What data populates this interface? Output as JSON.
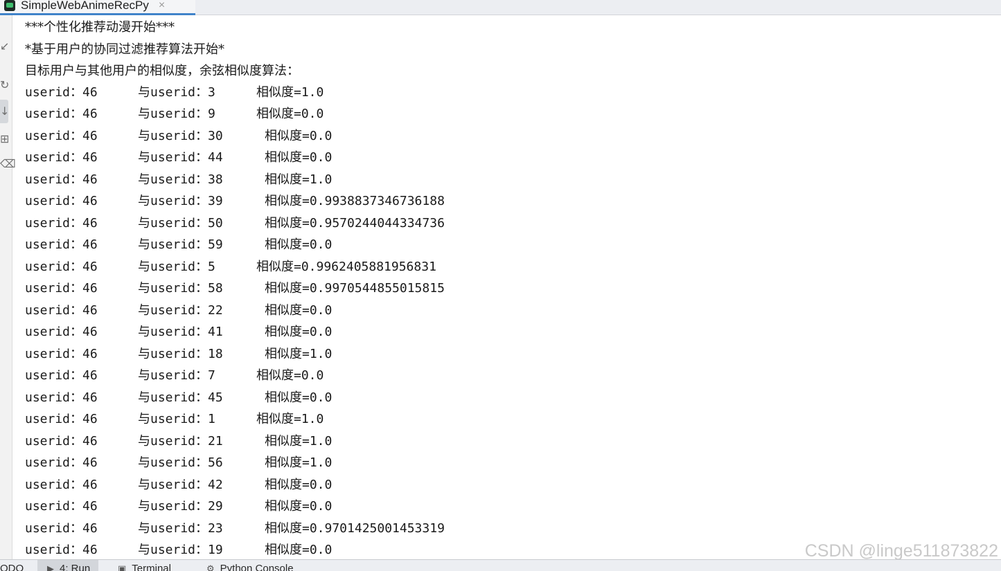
{
  "tab": {
    "title": "SimpleWebAnimeRecPy",
    "close_glyph": "×"
  },
  "gutter": {
    "icons": [
      "↙",
      "↻",
      "↓",
      "⊞",
      "⌫"
    ]
  },
  "console": {
    "header_lines": [
      "***个性化推荐动漫开始***",
      "*基于用户的协同过滤推荐算法开始*",
      "目标用户与其他用户的相似度，余弦相似度算法："
    ],
    "rows": [
      {
        "user": "userid：46",
        "other": "与userid：3",
        "sim": "相似度=1.0"
      },
      {
        "user": "userid：46",
        "other": "与userid：9",
        "sim": "相似度=0.0"
      },
      {
        "user": "userid：46",
        "other": "与userid：30",
        "sim": "相似度=0.0"
      },
      {
        "user": "userid：46",
        "other": "与userid：44",
        "sim": "相似度=0.0"
      },
      {
        "user": "userid：46",
        "other": "与userid：38",
        "sim": "相似度=1.0"
      },
      {
        "user": "userid：46",
        "other": "与userid：39",
        "sim": "相似度=0.9938837346736188"
      },
      {
        "user": "userid：46",
        "other": "与userid：50",
        "sim": "相似度=0.9570244044334736"
      },
      {
        "user": "userid：46",
        "other": "与userid：59",
        "sim": "相似度=0.0"
      },
      {
        "user": "userid：46",
        "other": "与userid：5",
        "sim": "相似度=0.9962405881956831"
      },
      {
        "user": "userid：46",
        "other": "与userid：58",
        "sim": "相似度=0.9970544855015815"
      },
      {
        "user": "userid：46",
        "other": "与userid：22",
        "sim": "相似度=0.0"
      },
      {
        "user": "userid：46",
        "other": "与userid：41",
        "sim": "相似度=0.0"
      },
      {
        "user": "userid：46",
        "other": "与userid：18",
        "sim": "相似度=1.0"
      },
      {
        "user": "userid：46",
        "other": "与userid：7",
        "sim": "相似度=0.0"
      },
      {
        "user": "userid：46",
        "other": "与userid：45",
        "sim": "相似度=0.0"
      },
      {
        "user": "userid：46",
        "other": "与userid：1",
        "sim": "相似度=1.0"
      },
      {
        "user": "userid：46",
        "other": "与userid：21",
        "sim": "相似度=1.0"
      },
      {
        "user": "userid：46",
        "other": "与userid：56",
        "sim": "相似度=1.0"
      },
      {
        "user": "userid：46",
        "other": "与userid：42",
        "sim": "相似度=0.0"
      },
      {
        "user": "userid：46",
        "other": "与userid：29",
        "sim": "相似度=0.0"
      },
      {
        "user": "userid：46",
        "other": "与userid：23",
        "sim": "相似度=0.9701425001453319"
      },
      {
        "user": "userid：46",
        "other": "与userid：19",
        "sim": "相似度=0.0"
      }
    ]
  },
  "watermark": "CSDN @linge511873822",
  "statusbar": {
    "todo": "ODO",
    "run": "4: Run",
    "terminal": "Terminal",
    "python_console": "Python Console"
  }
}
